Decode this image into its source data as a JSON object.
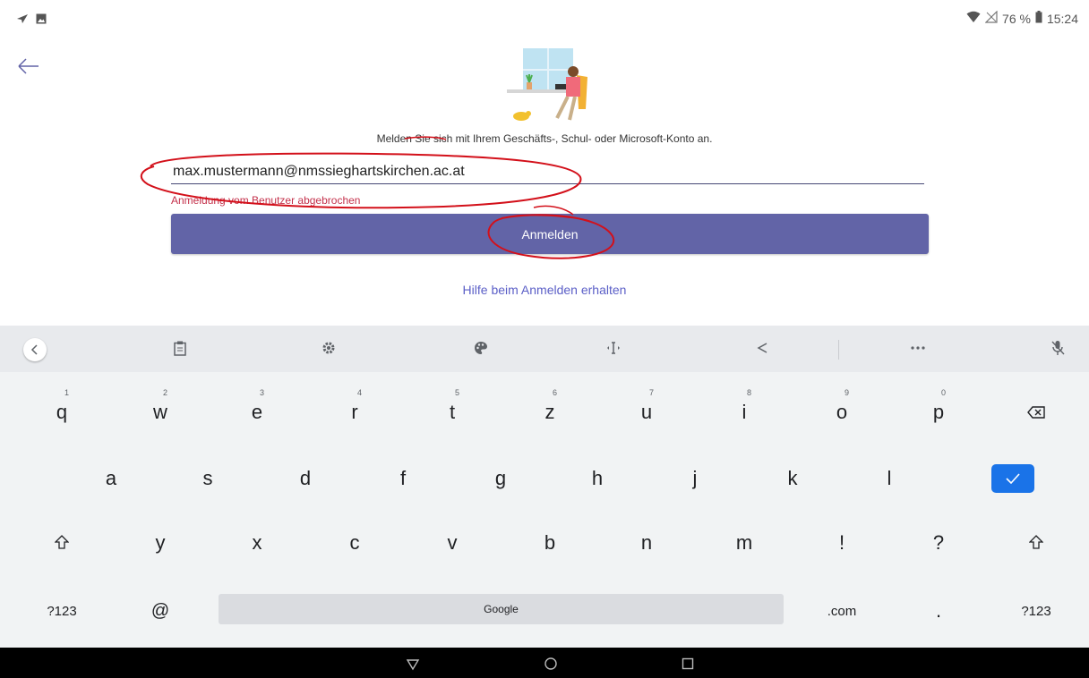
{
  "status_bar": {
    "battery_percent": "76 %",
    "time": "15:24"
  },
  "signin": {
    "prompt": "Melden Sie sich mit Ihrem Geschäfts-, Schul- oder Microsoft-Konto an.",
    "email_value": "max.mustermann@nmssieghartskirchen.ac.at",
    "error": "Anmeldung vom Benutzer abgebrochen",
    "button_label": "Anmelden",
    "help_link": "Hilfe beim Anmelden erhalten"
  },
  "keyboard": {
    "row1": [
      {
        "label": "q",
        "hint": "1"
      },
      {
        "label": "w",
        "hint": "2"
      },
      {
        "label": "e",
        "hint": "3"
      },
      {
        "label": "r",
        "hint": "4"
      },
      {
        "label": "t",
        "hint": "5"
      },
      {
        "label": "z",
        "hint": "6"
      },
      {
        "label": "u",
        "hint": "7"
      },
      {
        "label": "i",
        "hint": "8"
      },
      {
        "label": "o",
        "hint": "9"
      },
      {
        "label": "p",
        "hint": "0"
      }
    ],
    "row2": [
      "a",
      "s",
      "d",
      "f",
      "g",
      "h",
      "j",
      "k",
      "l"
    ],
    "row3": [
      "y",
      "x",
      "c",
      "v",
      "b",
      "n",
      "m",
      "!",
      "?"
    ],
    "symbols_label": "?123",
    "at_label": "@",
    "space_label": "Google",
    "dotcom_label": ".com",
    "period_label": "."
  },
  "colors": {
    "accent": "#6264a7",
    "error": "#c4314b",
    "link": "#5b5fc7",
    "enter_key": "#1a73e8",
    "annotation": "#d3101a"
  }
}
